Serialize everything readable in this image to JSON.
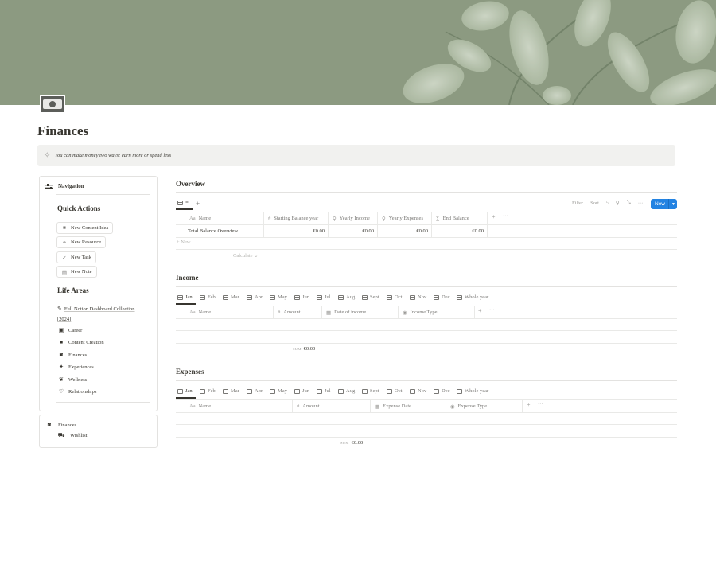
{
  "page": {
    "title": "Finances",
    "callout": "You can make money two ways: earn more or spend less",
    "colors": {
      "cover": "#8c9a81",
      "accent": "#2383e2",
      "text": "#37352f",
      "muted": "#787774"
    }
  },
  "navigation": {
    "title": "Navigation",
    "quick_actions_title": "Quick Actions",
    "quick_actions": [
      {
        "label": "New Content Idea",
        "icon": "video-icon"
      },
      {
        "label": "New Resource",
        "icon": "link-icon"
      },
      {
        "label": "New Task",
        "icon": "checkmark-icon"
      },
      {
        "label": "New Note",
        "icon": "note-icon"
      }
    ],
    "life_areas_title": "Life Areas",
    "life_areas": [
      {
        "label": "Full Notion Dashboard Collection [2024]",
        "icon": "feather-icon"
      },
      {
        "label": "Career",
        "icon": "briefcase-icon"
      },
      {
        "label": "Content Creation",
        "icon": "video-icon"
      },
      {
        "label": "Finances",
        "icon": "money-icon"
      },
      {
        "label": "Experiences",
        "icon": "sparkles-icon"
      },
      {
        "label": "Wellness",
        "icon": "leaf-icon"
      },
      {
        "label": "Relationships",
        "icon": "heart-icon"
      }
    ]
  },
  "finance_tree": {
    "root": "Finances",
    "child": "Wishlist"
  },
  "overview": {
    "title": "Overview",
    "view_tab": "≡",
    "toolbar": {
      "filter": "Filter",
      "sort": "Sort",
      "new_label": "New"
    },
    "columns": [
      "Name",
      "Starting Balance year",
      "Yearly Income",
      "Yearly Expenses",
      "End Balance"
    ],
    "rows": [
      {
        "name": "Total Balance Overview",
        "starting": "€0.00",
        "income": "€0.00",
        "expenses": "€0.00",
        "end": "€0.00"
      }
    ],
    "new_row": "New",
    "calculate": "Calculate"
  },
  "income": {
    "title": "Income",
    "tabs": [
      "Jan",
      "Feb",
      "Mar",
      "Apr",
      "May",
      "Jun",
      "Jul",
      "Aug",
      "Sept",
      "Oct",
      "Nov",
      "Dec",
      "Whole year"
    ],
    "columns": [
      "Name",
      "Amount",
      "Date of income",
      "Income Type"
    ],
    "sum_label": "SUM",
    "sum_value": "€0.00"
  },
  "expenses": {
    "title": "Expenses",
    "tabs": [
      "Jan",
      "Feb",
      "Mar",
      "Apr",
      "May",
      "Jun",
      "Jul",
      "Aug",
      "Sept",
      "Oct",
      "Nov",
      "Dec",
      "Whole year"
    ],
    "columns": [
      "Name",
      "Amount",
      "Expense Date",
      "Expense Type"
    ],
    "sum_label": "SUM",
    "sum_value": "€0.00"
  }
}
